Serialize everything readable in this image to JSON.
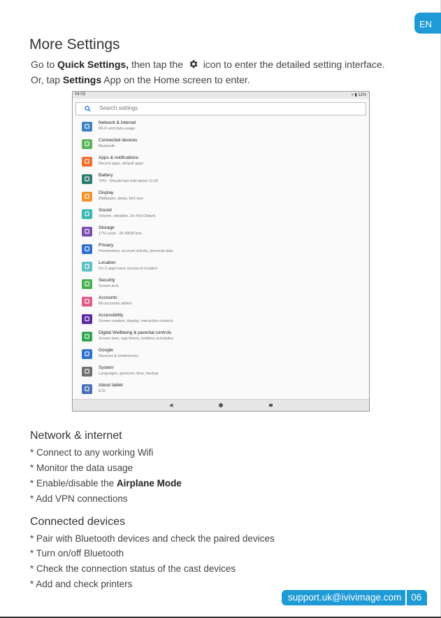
{
  "language_tab": "EN",
  "title": "More Settings",
  "intro": {
    "line1_a": "Go to",
    "line1_b": "Quick Settings,",
    "line1_c": "then tap the",
    "line1_d": "icon to enter the detailed setting interface.",
    "line2_a": "Or, tap",
    "line2_b": "Settings",
    "line2_c": "App on the Home screen to enter."
  },
  "screenshot": {
    "time": "04:03",
    "status_right": "▿ ▮ 11%",
    "search_placeholder": "Search settings",
    "items": [
      {
        "label": "Network & internet",
        "sub": "Wi-Fi and data usage",
        "icon": "wifi-icon",
        "color": "#3b82c4"
      },
      {
        "label": "Connected devices",
        "sub": "Bluetooth",
        "icon": "devices-icon",
        "color": "#5ab55a"
      },
      {
        "label": "Apps & notifications",
        "sub": "Recent apps, default apps",
        "icon": "apps-icon",
        "color": "#f26d2b"
      },
      {
        "label": "Battery",
        "sub": "70% - Should last until about 10:30",
        "icon": "battery-icon",
        "color": "#2e7d6e"
      },
      {
        "label": "Display",
        "sub": "Wallpaper, sleep, font size",
        "icon": "display-icon",
        "color": "#f0942b"
      },
      {
        "label": "Sound",
        "sub": "Volume, vibration, Do Not Disturb",
        "icon": "sound-icon",
        "color": "#3ab8b0"
      },
      {
        "label": "Storage",
        "sub": "17% used - 26.49GB free",
        "icon": "storage-icon",
        "color": "#7b4fb0"
      },
      {
        "label": "Privacy",
        "sub": "Permissions, account activity, personal data",
        "icon": "privacy-icon",
        "color": "#2f6fd1"
      },
      {
        "label": "Location",
        "sub": "On-2 apps have access to location",
        "icon": "location-icon",
        "color": "#5ec0c0"
      },
      {
        "label": "Security",
        "sub": "Screen lock",
        "icon": "security-icon",
        "color": "#4caf50"
      },
      {
        "label": "Accounts",
        "sub": "No accounts added",
        "icon": "accounts-icon",
        "color": "#e05a8a"
      },
      {
        "label": "Accessibility",
        "sub": "Screen readers, display, interaction controls",
        "icon": "accessibility-icon",
        "color": "#5b2aa0"
      },
      {
        "label": "Digital Wellbeing & parental controls",
        "sub": "Screen time, app timers, bedtime schedules",
        "icon": "wellbeing-icon",
        "color": "#2ea84f"
      },
      {
        "label": "Google",
        "sub": "Services & preferences",
        "icon": "google-icon",
        "color": "#2f6fd1"
      },
      {
        "label": "System",
        "sub": "Languages, gestures, time, backup",
        "icon": "system-icon",
        "color": "#707070"
      },
      {
        "label": "About tablet",
        "sub": "E10",
        "icon": "about-icon",
        "color": "#4a6fb5"
      }
    ]
  },
  "network": {
    "heading": "Network & internet",
    "b1": "* Connect to any working Wifi",
    "b2": "* Monitor the data usage",
    "b3_a": "* Enable/disable the",
    "b3_b": "Airplane Mode",
    "b4": "* Add VPN connections"
  },
  "devices": {
    "heading": "Connected devices",
    "b1": "* Pair with Bluetooth devices and check the paired devices",
    "b2": "* Turn on/off Bluetooth",
    "b3": "* Check the connection status of the cast devices",
    "b4": "* Add and check printers"
  },
  "footer": {
    "email": "support.uk@ivivimage.com",
    "page": "06"
  }
}
